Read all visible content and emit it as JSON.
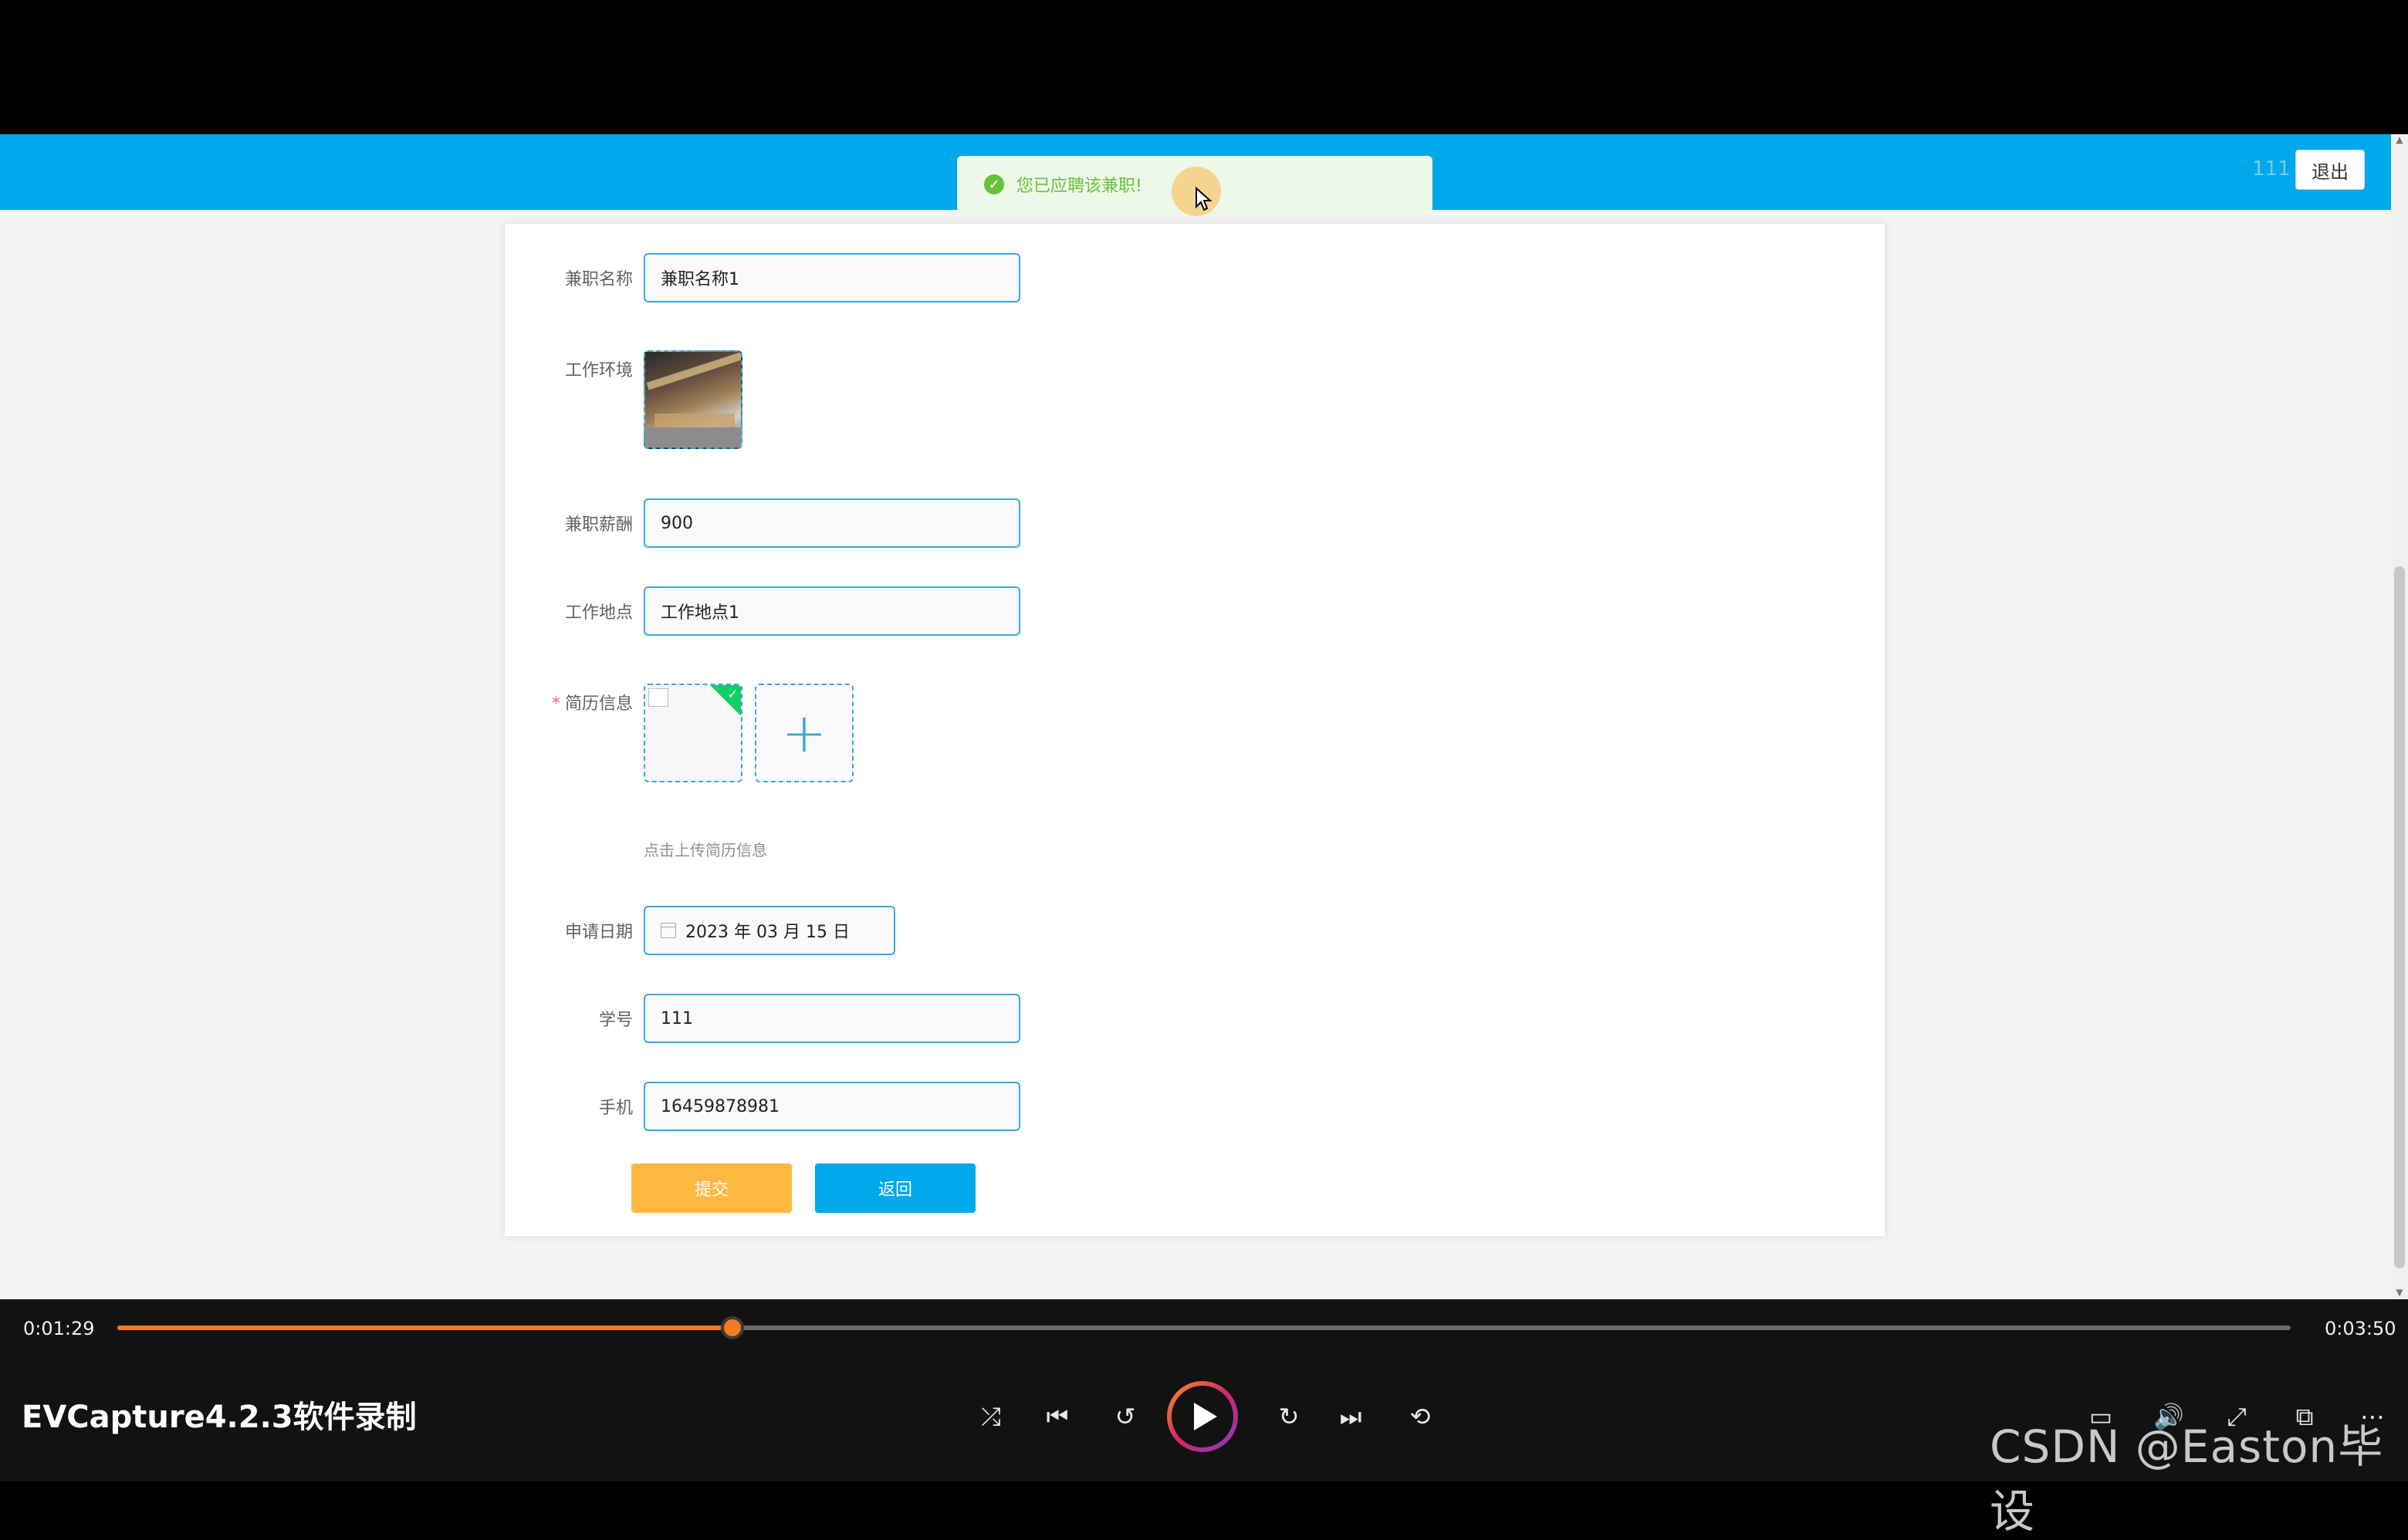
{
  "header": {
    "username": "111",
    "logout_label": "退出"
  },
  "toast": {
    "message": "您已应聘该兼职!"
  },
  "form": {
    "name_label": "兼职名称",
    "name_value": "兼职名称1",
    "env_label": "工作环境",
    "salary_label": "兼职薪酬",
    "salary_value": "900",
    "location_label": "工作地点",
    "location_value": "工作地点1",
    "resume_label": "简历信息",
    "resume_required_mark": "*",
    "resume_hint": "点击上传简历信息",
    "date_label": "申请日期",
    "date_value": "2023 年 03 月 15 日",
    "student_id_label": "学号",
    "student_id_value": "111",
    "phone_label": "手机",
    "phone_value": "16459878981",
    "submit_label": "提交",
    "back_label": "返回"
  },
  "player": {
    "current_time": "0:01:29",
    "total_time": "0:03:50",
    "progress_fraction": 0.283,
    "title": "EVCapture4.2.3软件录制",
    "watermark": "CSDN @Easton毕设"
  },
  "icons": {
    "toast": "success-check-icon",
    "shuffle": "shuffle-icon",
    "previous": "skip-previous-icon",
    "rewind": "rewind-10-icon",
    "play": "play-icon",
    "forward": "forward-30-icon",
    "next": "skip-next-icon",
    "repeat": "repeat-off-icon",
    "subtitles": "subtitles-icon",
    "volume": "volume-icon",
    "fullscreen": "fullscreen-icon",
    "miniplayer": "miniplayer-icon",
    "more": "more-icon"
  },
  "colors": {
    "header": "#00a8ec",
    "accent": "#f47b20",
    "submit": "#ffb840",
    "success": "#67c23a"
  }
}
